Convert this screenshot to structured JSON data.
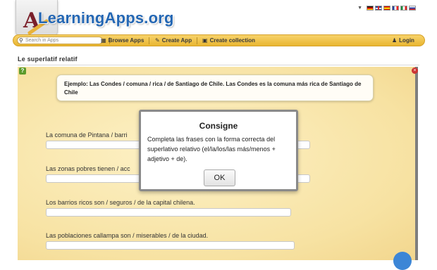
{
  "header": {
    "logo_text": "LearningApps.org",
    "logo_letter": "A",
    "languages": [
      {
        "code": "de",
        "icon": "flag-de"
      },
      {
        "code": "en",
        "icon": "flag-uk"
      },
      {
        "code": "es",
        "icon": "flag-es"
      },
      {
        "code": "fr",
        "icon": "flag-fr"
      },
      {
        "code": "it",
        "icon": "flag-it"
      },
      {
        "code": "ru",
        "icon": "flag-ru"
      }
    ]
  },
  "nav": {
    "search_placeholder": "Search in Apps",
    "browse_label": "Browse Apps",
    "create_label": "Create App",
    "collection_label": "Create collection",
    "login_label": "Login",
    "bar_color": "#eec14a"
  },
  "page": {
    "title": "Le superlatif relatif"
  },
  "app": {
    "example": "Ejemplo: Las Condes / comuna / rica / de Santiago de Chile. Las Condes es la comuna más rica de Santiago de Chile",
    "questions": [
      {
        "label": "La comuna de Pintana / barri",
        "value": ""
      },
      {
        "label": "Las zonas pobres tienen / acc",
        "value": ""
      },
      {
        "label": "Los barrios ricos son / seguros / de la capital chilena.",
        "value": ""
      },
      {
        "label": "Las poblaciones callampa son / miserables / de la ciudad.",
        "value": ""
      }
    ],
    "background_color": "#f7e2a2"
  },
  "modal": {
    "title": "Consigne",
    "body": "Completa las frases con la forma correcta del superlativo relativo (el/la/los/las más/menos + adjetivo + de).",
    "ok_label": "OK"
  }
}
